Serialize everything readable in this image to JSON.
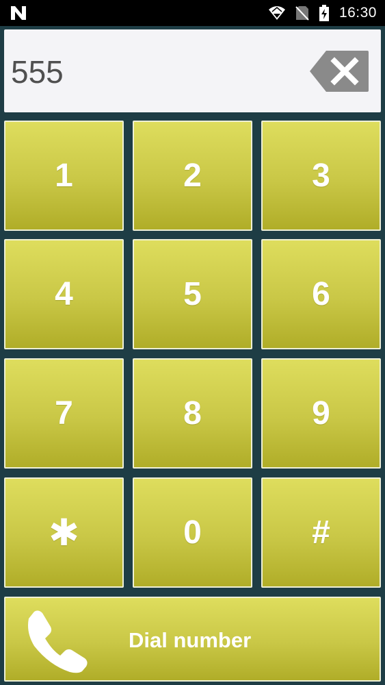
{
  "status_bar": {
    "time": "16:30",
    "icons": [
      "n-notification-icon",
      "wifi-icon",
      "no-sim-icon",
      "battery-charging-icon"
    ]
  },
  "display": {
    "number": "555",
    "backspace_icon": "backspace-icon"
  },
  "keypad": {
    "keys": [
      {
        "label": "1",
        "name": "key-1"
      },
      {
        "label": "2",
        "name": "key-2"
      },
      {
        "label": "3",
        "name": "key-3"
      },
      {
        "label": "4",
        "name": "key-4"
      },
      {
        "label": "5",
        "name": "key-5"
      },
      {
        "label": "6",
        "name": "key-6"
      },
      {
        "label": "7",
        "name": "key-7"
      },
      {
        "label": "8",
        "name": "key-8"
      },
      {
        "label": "9",
        "name": "key-9"
      },
      {
        "label": "✱",
        "name": "key-star"
      },
      {
        "label": "0",
        "name": "key-0"
      },
      {
        "label": "#",
        "name": "key-hash"
      }
    ]
  },
  "dial": {
    "label": "Dial number",
    "icon": "phone-icon"
  },
  "colors": {
    "background": "#1e3d45",
    "key_top": "#dedd5d",
    "key_bottom": "#b0ad28",
    "display_bg": "#f4f4f7",
    "backspace": "#8a8a8a"
  }
}
